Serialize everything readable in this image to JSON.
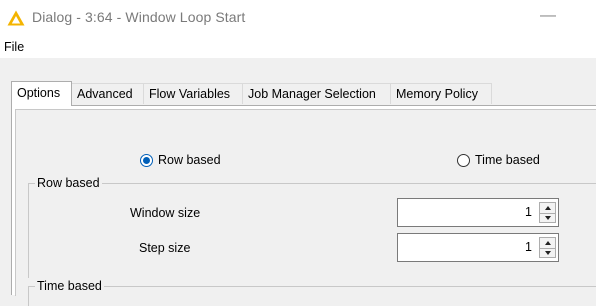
{
  "window": {
    "title": "Dialog - 3:64 - Window Loop Start",
    "app_icon": "knime-warning-triangle-icon",
    "minimize_glyph": "—"
  },
  "menu": {
    "file": "File"
  },
  "tabs": [
    {
      "label": "Options",
      "active": true
    },
    {
      "label": "Advanced",
      "active": false
    },
    {
      "label": "Flow Variables",
      "active": false
    },
    {
      "label": "Job Manager Selection",
      "active": false
    },
    {
      "label": "Memory Policy",
      "active": false
    }
  ],
  "mode": {
    "row_based_label": "Row based",
    "time_based_label": "Time based",
    "selected": "Row based"
  },
  "row_group": {
    "legend": "Row based",
    "window_size_label": "Window size",
    "window_size_value": "1",
    "step_size_label": "Step size",
    "step_size_value": "1"
  },
  "time_group": {
    "legend": "Time based"
  },
  "colors": {
    "accent": "#005fb8",
    "icon_yellow": "#f4b400"
  }
}
